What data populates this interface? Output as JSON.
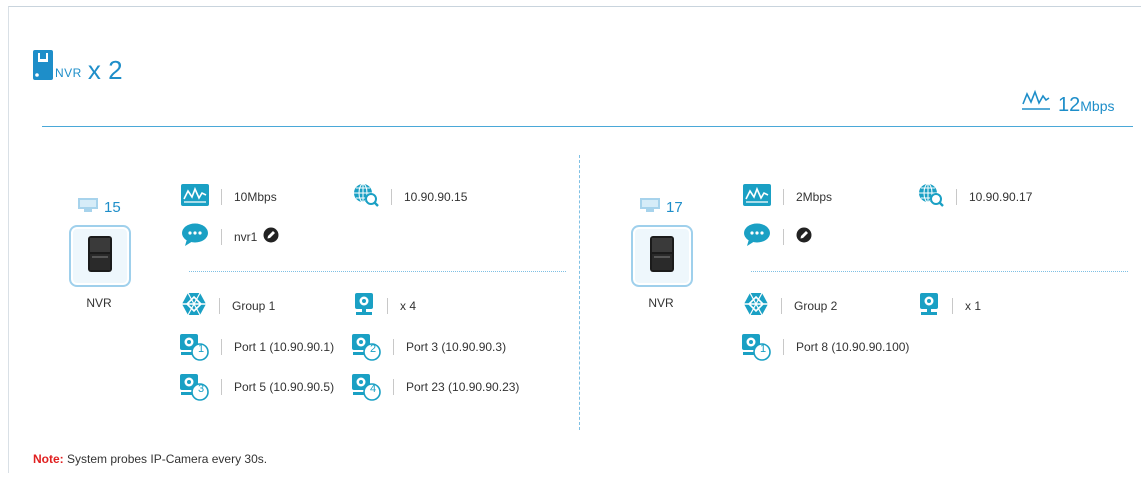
{
  "header": {
    "device_word": "NVR",
    "device_multiplier": "x 2",
    "total_bandwidth_value": "12",
    "total_bandwidth_unit": "Mbps"
  },
  "nvrs": [
    {
      "count": "15",
      "label": "NVR",
      "bandwidth": "10Mbps",
      "ip": "10.90.90.15",
      "name": "nvr1",
      "group": "Group 1",
      "camera_count": "x 4",
      "ports": [
        {
          "index": "1",
          "text": "Port 1 (10.90.90.1)"
        },
        {
          "index": "2",
          "text": "Port 3 (10.90.90.3)"
        },
        {
          "index": "3",
          "text": "Port 5 (10.90.90.5)"
        },
        {
          "index": "4",
          "text": "Port 23 (10.90.90.23)"
        }
      ]
    },
    {
      "count": "17",
      "label": "NVR",
      "bandwidth": "2Mbps",
      "ip": "10.90.90.17",
      "name": "",
      "group": "Group 2",
      "camera_count": "x 1",
      "ports": [
        {
          "index": "1",
          "text": "Port 8 (10.90.90.100)"
        }
      ]
    }
  ],
  "note": {
    "label": "Note:",
    "text": " System probes IP-Camera every 30s."
  },
  "colors": {
    "accent": "#1e8ec9",
    "icon_teal": "#1aa0c4",
    "note_red": "#e02020"
  },
  "icons": {
    "device": "nvr-device-icon",
    "bandwidth": "bandwidth-chart-icon",
    "ip": "globe-search-icon",
    "name": "speech-bubble-icon",
    "edit": "edit-pencil-icon",
    "group": "group-hexagon-icon",
    "camera": "ip-camera-icon"
  }
}
